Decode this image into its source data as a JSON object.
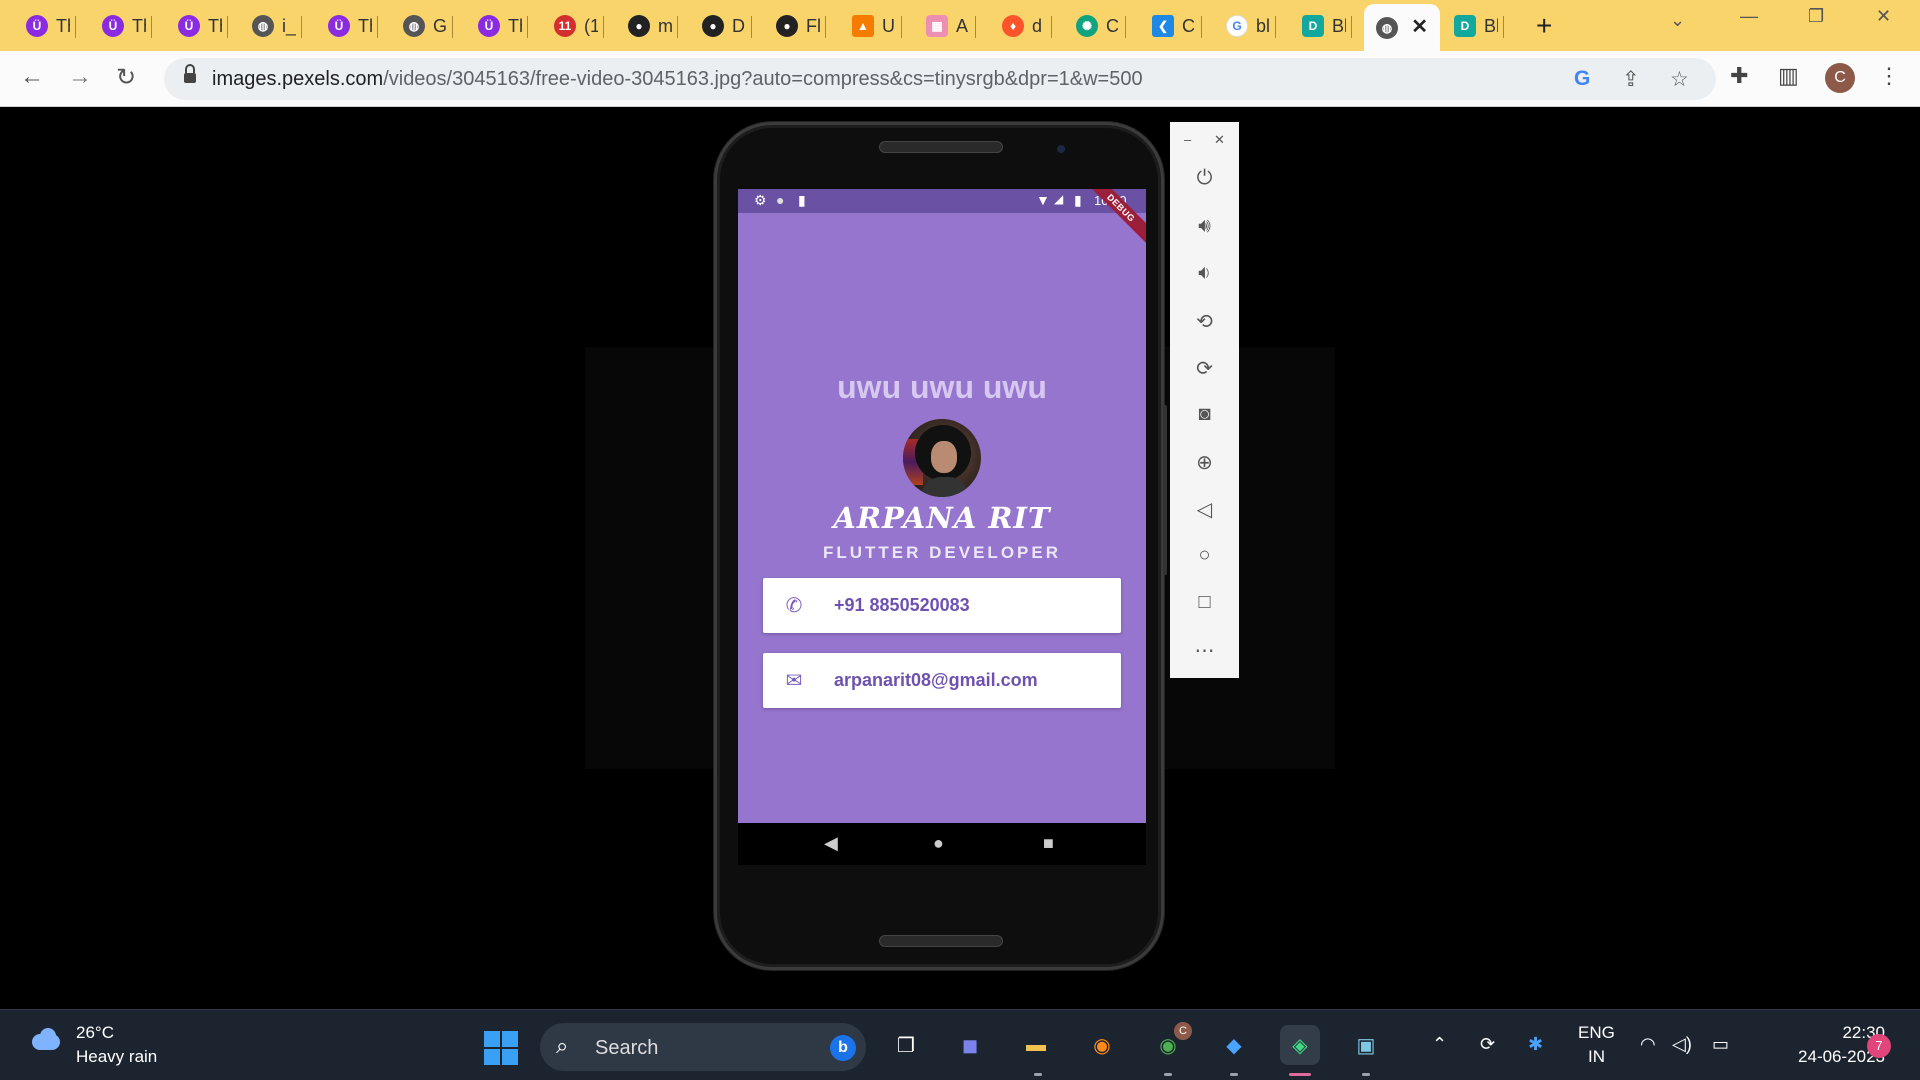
{
  "browser": {
    "tabs": [
      {
        "title": "Th",
        "icon": "udemy-icon"
      },
      {
        "title": "Th",
        "icon": "udemy-icon"
      },
      {
        "title": "Th",
        "icon": "udemy-icon"
      },
      {
        "title": "i_",
        "icon": "globe-icon"
      },
      {
        "title": "Th",
        "icon": "udemy-icon"
      },
      {
        "title": "G",
        "icon": "globe-icon"
      },
      {
        "title": "Th",
        "icon": "udemy-icon"
      },
      {
        "title": "(1",
        "icon": "notification-icon",
        "badge": "11"
      },
      {
        "title": "m",
        "icon": "github-icon"
      },
      {
        "title": "D",
        "icon": "github-icon"
      },
      {
        "title": "Fl",
        "icon": "github-icon"
      },
      {
        "title": "U",
        "icon": "diagram-icon"
      },
      {
        "title": "A",
        "icon": "grid-icon"
      },
      {
        "title": "d",
        "icon": "brave-icon"
      },
      {
        "title": "Cl",
        "icon": "openai-icon"
      },
      {
        "title": "C",
        "icon": "flutter-icon"
      },
      {
        "title": "bl",
        "icon": "google-icon"
      },
      {
        "title": "Bl",
        "icon": "dartpad-icon"
      },
      {
        "title": "",
        "icon": "globe-icon",
        "active": true
      },
      {
        "title": "Bl",
        "icon": "dartpad-icon"
      }
    ],
    "url_host": "images.pexels.com",
    "url_path": "/videos/3045163/free-video-3045163.jpg?auto=compress&cs=tinysrgb&dpr=1&w=500",
    "profile_initial": "C"
  },
  "phone": {
    "status_time": "10:30",
    "debug_label": "DEBUG",
    "app": {
      "title": "uwu uwu uwu",
      "name": "ARPANA RIT",
      "role": "FLUTTER DEVELOPER",
      "phone": "+91 8850520083",
      "email": "arpanarit08@gmail.com"
    }
  },
  "taskbar": {
    "temperature": "26°C",
    "weather": "Heavy rain",
    "search_placeholder": "Search",
    "lang_top": "ENG",
    "lang_bottom": "IN",
    "time": "22:30",
    "date": "24-06-2023",
    "notifications": "7",
    "chrome_badge": "C"
  },
  "colors": {
    "tabstrip": "#f9d46b",
    "app_background": "#9575cd",
    "status_bar": "#6a51a3",
    "card_text": "#6f52b0",
    "taskbar": "#1c2430"
  }
}
